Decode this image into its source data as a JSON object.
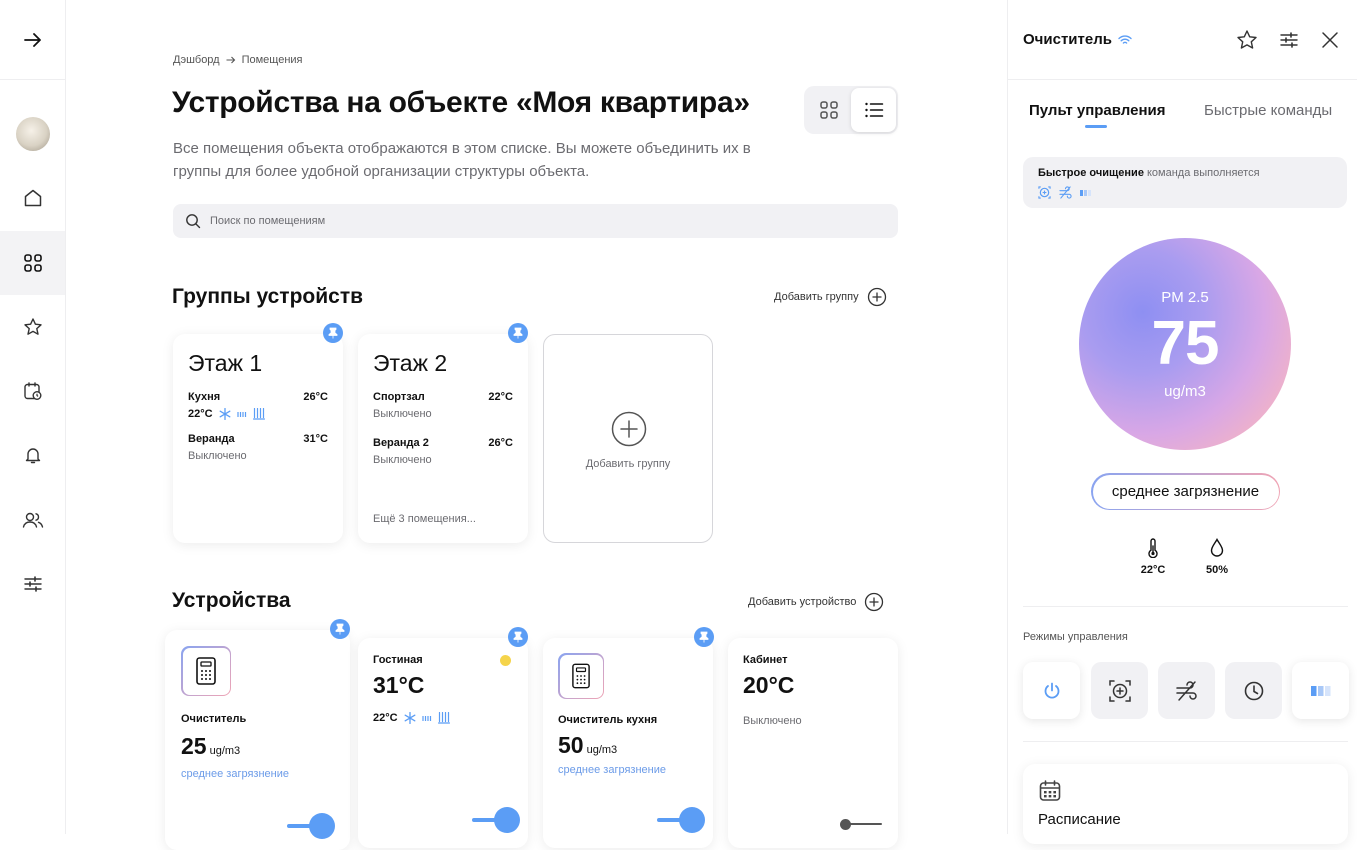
{
  "breadcrumb": {
    "home": "Дэшборд",
    "current": "Помещения"
  },
  "page": {
    "title": "Устройства на объекте «Моя квартира»",
    "description": "Все помещения объекта отображаются в этом списке. Вы можете объединить их в группы для более удобной организации структуры объекта."
  },
  "search": {
    "placeholder": "Поиск по помещениям",
    "value": ""
  },
  "groups": {
    "heading": "Группы устройств",
    "add_label": "Добавить группу",
    "add_card_label": "Добавить группу",
    "items": [
      {
        "title": "Этаж 1",
        "rooms": [
          {
            "name": "Кухня",
            "temp": "26°C",
            "sub": "22°C"
          },
          {
            "name": "Веранда",
            "temp": "31°C",
            "sub": "Выключено"
          }
        ]
      },
      {
        "title": "Этаж 2",
        "rooms": [
          {
            "name": "Спортзал",
            "temp": "22°C",
            "sub": "Выключено"
          },
          {
            "name": "Веранда 2",
            "temp": "26°C",
            "sub": "Выключено"
          }
        ],
        "more": "Ещё 3 помещения..."
      }
    ]
  },
  "devices": {
    "heading": "Устройства",
    "add_label": "Добавить устройство",
    "items": [
      {
        "name": "Очиститель",
        "value": "25",
        "unit": "ug/m3",
        "status": "среднее загрязнение",
        "on": true
      },
      {
        "name": "Гостиная",
        "value": "31°C",
        "sub": "22°C",
        "on": true
      },
      {
        "name": "Очиститель кухня",
        "value": "50",
        "unit": "ug/m3",
        "status": "среднее загрязнение",
        "on": true
      },
      {
        "name": "Кабинет",
        "value": "20°C",
        "sub": "Выключено",
        "on": false
      }
    ]
  },
  "panel": {
    "title": "Очиститель",
    "tabs": [
      "Пульт управления",
      "Быстрые команды"
    ],
    "quick": {
      "label": "Быстрое очищение",
      "status": "команда выполняется"
    },
    "pm": {
      "label": "PM 2.5",
      "value": "75",
      "unit": "ug/m3"
    },
    "pollution": "среднее загрязнение",
    "temperature": "22°C",
    "humidity": "50%",
    "modes_label": "Режимы управления",
    "schedule": "Расписание"
  },
  "colors": {
    "accent": "#5b9df5",
    "status_text": "#6b9be8",
    "status_dot": "#f5d44b"
  }
}
